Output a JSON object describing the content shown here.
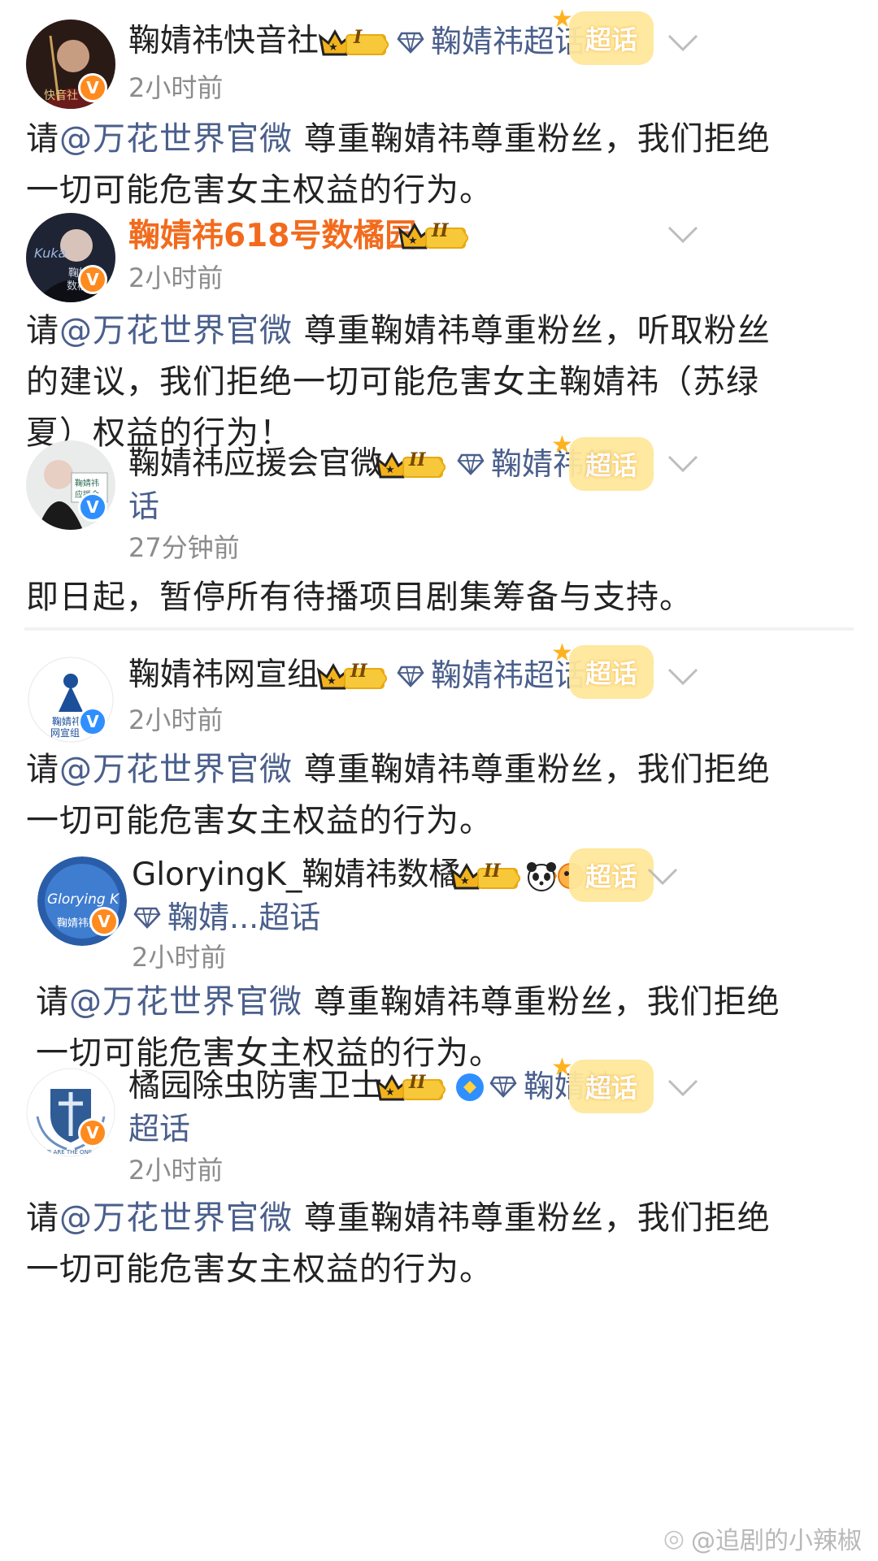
{
  "posts": [
    {
      "name": "鞠婧祎快音社",
      "level": "I",
      "topic": "鞠婧祎超话",
      "sticker": "超话",
      "time": "2小时前",
      "mention": "@万花世界官微",
      "text_after_mention": " 尊重鞠婧祎尊重粉丝，我们拒绝",
      "text_line2": "一切可能危害女主权益的行为。"
    },
    {
      "name": "鞠婧祎618号数橘园",
      "level": "II",
      "time": "2小时前",
      "mention": "@万花世界官微",
      "text_after_mention": " 尊重鞠婧祎尊重粉丝，听取粉丝",
      "text_line2": "的建议，我们拒绝一切可能危害女主鞠婧祎（苏绿",
      "text_line3": "夏）权益的行为！"
    },
    {
      "name": "鞠婧祎应援会官微",
      "level": "II",
      "topic_part1": "鞠婧祎超",
      "topic_part2": "话",
      "sticker": "超话",
      "time": "27分钟前",
      "text": "即日起，暂停所有待播项目剧集筹备与支持。"
    },
    {
      "name": "鞠婧祎网宣组",
      "level": "II",
      "topic": "鞠婧祎超话",
      "sticker": "超话",
      "time": "2小时前",
      "mention": "@万花世界官微",
      "text_after_mention": " 尊重鞠婧祎尊重粉丝，我们拒绝",
      "text_line2": "一切可能危害女主权益的行为。"
    },
    {
      "name": "GloryingK_鞠婧祎数橘...",
      "level": "II",
      "topic": "鞠婧...超话",
      "sticker": "超话",
      "time": "2小时前",
      "mention": "@万花世界官微",
      "text_after_mention": " 尊重鞠婧祎尊重粉丝，我们拒绝",
      "text_line2": "一切可能危害女主权益的行为。"
    },
    {
      "name": "橘园除虫防害卫士",
      "level": "II",
      "topic_part1": "鞠婧祎",
      "topic_part2": "超话",
      "sticker": "超话",
      "time": "2小时前",
      "mention": "@万花世界官微",
      "text_after_mention": " 尊重鞠婧祎尊重粉丝，我们拒绝",
      "text_line2": "一切可能危害女主权益的行为。"
    }
  ],
  "avatars": {
    "a5_text": "Glorying K",
    "a5_sub": "鞠婧祎数"
  },
  "watermark": "@追剧的小辣椒",
  "colors": {
    "link": "#4a5f8c",
    "orange_name": "#f26b1d",
    "time": "#8c8c8c",
    "vip_orange": "#ff8a1e",
    "vip_blue": "#2f8fff"
  }
}
